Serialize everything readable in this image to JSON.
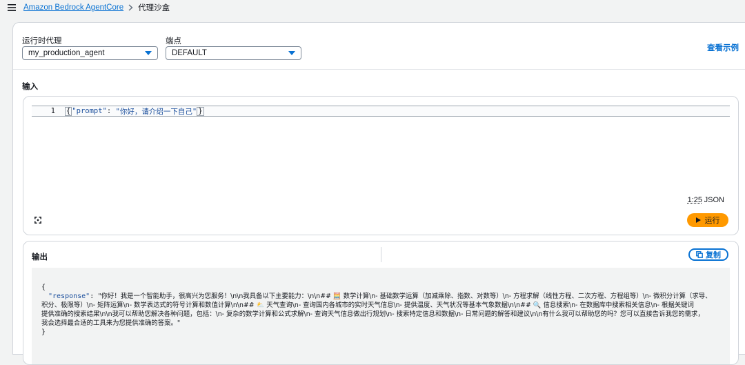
{
  "breadcrumb": {
    "root": "Amazon Bedrock AgentCore",
    "current": "代理沙盒"
  },
  "form": {
    "agent_label": "运行时代理",
    "agent_value": "my_production_agent",
    "endpoint_label": "端点",
    "endpoint_value": "DEFAULT",
    "view_example": "查看示例"
  },
  "input": {
    "label": "输入",
    "line_number": "1",
    "code": {
      "open_brace": "{",
      "key": "\"prompt\"",
      "colon": ": ",
      "value": "\"你好，请介绍一下自己\"",
      "close_brace": "}"
    },
    "cursor_pos": "1:25",
    "language": "JSON",
    "run_label": "运行"
  },
  "output": {
    "label": "输出",
    "copy_label": "复制",
    "json": {
      "open": "{",
      "key": "\"response\"",
      "colon": ": ",
      "line1": "\"你好！我是一个智能助手，很高兴为您服务！\\n\\n我具备以下主要能力：\\n\\n## 🧮 数学计算\\n- 基础数学运算（加减乘除、指数、对数等）\\n- 方程求解（线性方程、二次方程、方程组等）\\n- 微积分计算（求导、",
      "line2": "积分、极限等）\\n- 矩阵运算\\n- 数学表达式的符号计算和数值计算\\n\\n## ⛅ 天气查询\\n- 查询国内各城市的实时天气信息\\n- 提供温度、天气状况等基本气象数据\\n\\n## 🔍 信息搜索\\n- 在数据库中搜索相关信息\\n- 根据关键词",
      "line3": "提供准确的搜索结果\\n\\n我可以帮助您解决各种问题，包括：\\n- 复杂的数学计算和公式求解\\n- 查询天气信息做出行规划\\n- 搜索特定信息和数据\\n- 日常问题的解答和建议\\n\\n有什么我可以帮助您的吗？您可以直接告诉我您的需求，",
      "line4": "我会选择最合适的工具来为您提供准确的答案。\"",
      "close": "}"
    }
  },
  "colors": {
    "accent": "#0972d3",
    "run_button": "#ff9900"
  },
  "icons": {
    "menu": "hamburger-menu-icon",
    "separator": "chevron-right-icon",
    "expand": "expand-icon",
    "play": "play-icon",
    "copy": "copy-icon"
  }
}
